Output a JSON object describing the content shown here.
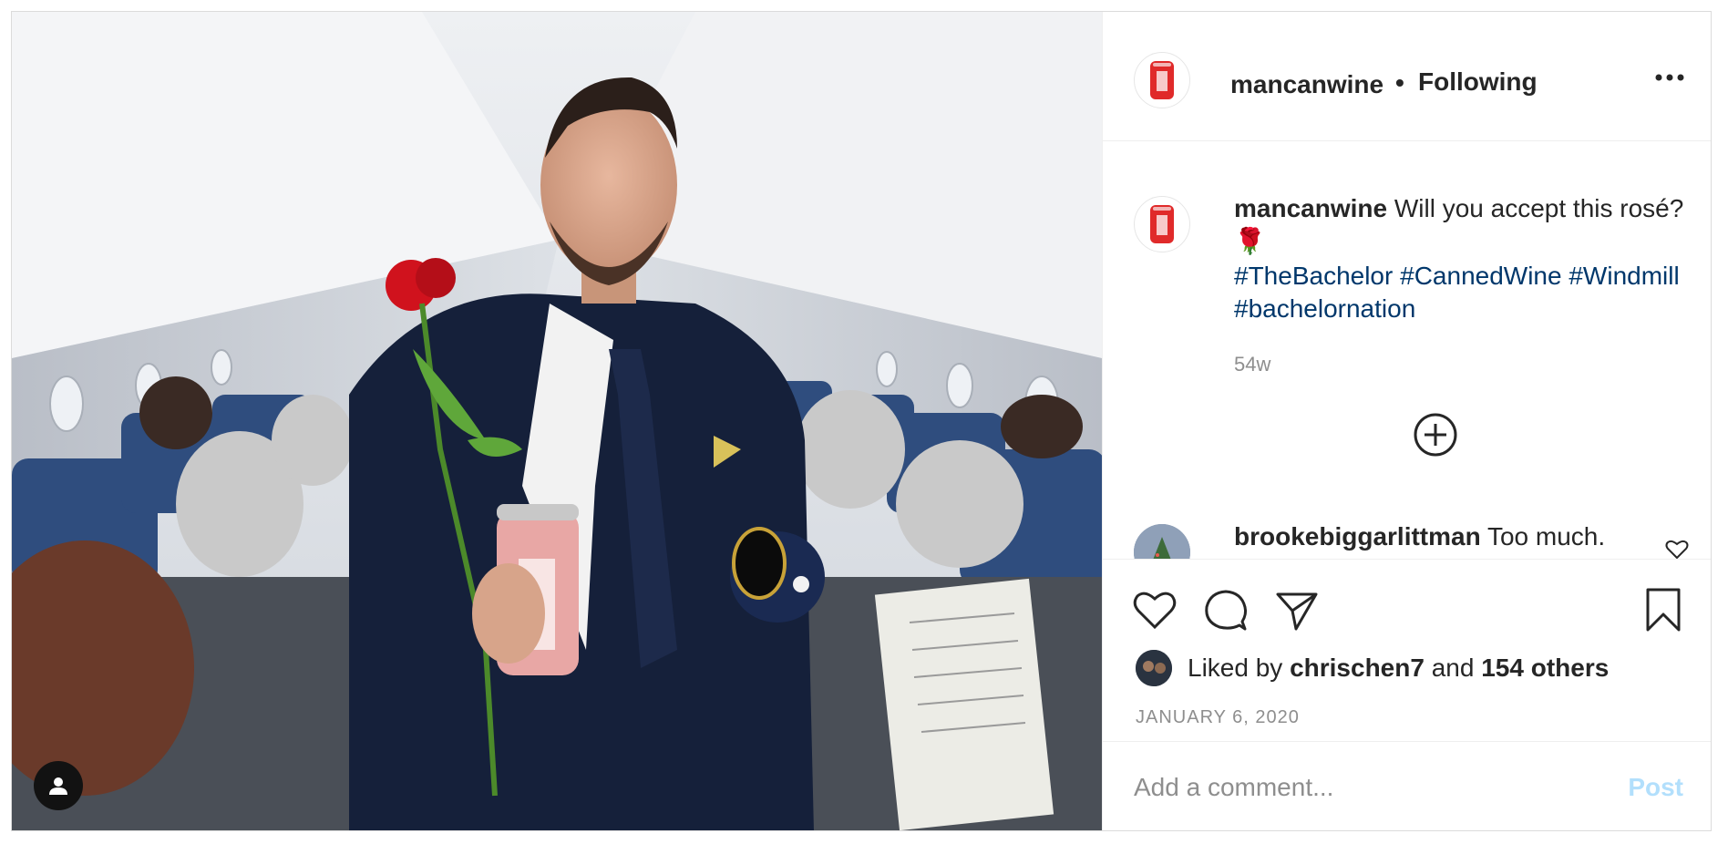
{
  "header": {
    "username": "mancanwine",
    "separator": "•",
    "follow_status": "Following"
  },
  "caption": {
    "username": "mancanwine",
    "text": "Will you accept this rosé?",
    "emoji": "🌹",
    "hashtags": [
      "#TheBachelor",
      "#CannedWine",
      "#Windmill",
      "#bachelornation"
    ],
    "time": "54w"
  },
  "comments": [
    {
      "username": "brookebiggarlittman",
      "text": "Too much."
    }
  ],
  "likes": {
    "prefix": "Liked by",
    "user": "chrischen7",
    "joiner": "and",
    "others": "154 others"
  },
  "date": "JANUARY 6, 2020",
  "add_comment": {
    "placeholder": "Add a comment...",
    "post_label": "Post"
  },
  "icons": {
    "more": "more-options-icon",
    "load_more": "load-more-comments-icon",
    "like": "heart-icon",
    "comment": "comment-icon",
    "share": "share-icon",
    "save": "bookmark-icon",
    "user_tag": "user-tag-icon"
  },
  "colors": {
    "link": "#00376b",
    "muted": "#8e8e8e",
    "post_disabled": "#b2dffc",
    "brand_can": "#e02a2a"
  }
}
